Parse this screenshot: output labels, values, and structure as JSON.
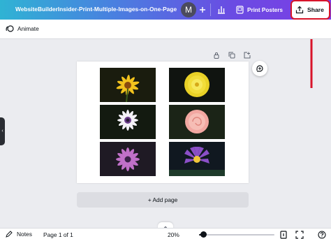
{
  "topbar": {
    "doc_title": "WebsiteBuilderInsider-Print-Multiple-Images-on-One-Page",
    "avatar_initial": "M",
    "add_collaborator_icon": "plus-icon",
    "analytics_icon": "bar-chart-icon",
    "print_label": "Print Posters",
    "print_icon": "poster-icon",
    "share_label": "Share",
    "share_icon": "upload-icon",
    "highlight_color": "#d8142a"
  },
  "subbar": {
    "animate_label": "Animate",
    "animate_icon": "animate-icon"
  },
  "page_tools": [
    "lock-icon",
    "duplicate-icon",
    "add-page-icon"
  ],
  "page": {
    "images": [
      {
        "name": "yellow-daisy-image",
        "icon": "flower-image"
      },
      {
        "name": "yellow-dahlia-image",
        "icon": "flower-image"
      },
      {
        "name": "white-purple-daisy-image",
        "icon": "flower-image"
      },
      {
        "name": "pink-rose-image",
        "icon": "flower-image"
      },
      {
        "name": "purple-daisy-image",
        "icon": "flower-image"
      },
      {
        "name": "purple-water-lily-image",
        "icon": "flower-image"
      }
    ]
  },
  "add_page_label": "+ Add page",
  "bottombar": {
    "notes_label": "Notes",
    "page_indicator": "Page 1 of 1",
    "zoom": "20%",
    "zoom_fraction": 0.06,
    "icons": [
      "notes-icon",
      "page-count-icon",
      "fullscreen-icon",
      "help-icon"
    ]
  },
  "colors": {
    "gradient_start": "#2fb3d4",
    "gradient_end": "#7d3ce4",
    "canvas_bg": "#ebecf0"
  }
}
